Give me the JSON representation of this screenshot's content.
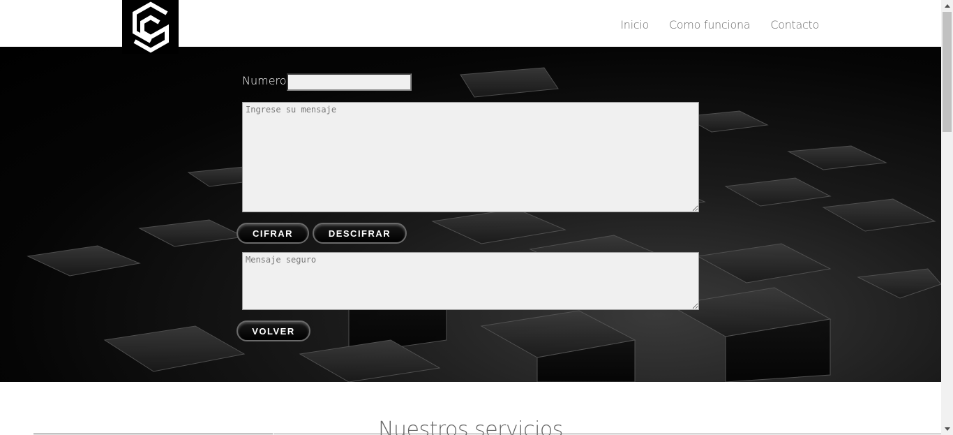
{
  "header": {
    "logo_icon": "cube-c-logo-icon",
    "nav": [
      {
        "label": "Inicio"
      },
      {
        "label": "Como funciona"
      },
      {
        "label": "Contacto"
      }
    ]
  },
  "form": {
    "numero_label": "Numero",
    "numero_value": "",
    "message_placeholder": "Ingrese su mensaje",
    "output_placeholder": "Mensaje seguro",
    "encrypt_label": "CIFRAR",
    "decrypt_label": "DESCIFRAR",
    "back_label": "VOLVER"
  },
  "services": {
    "title": "Nuestros servicios"
  },
  "colors": {
    "hero_bg": "#000000",
    "nav_text": "#6a6a6a",
    "field_bg": "#f0f0f0"
  }
}
